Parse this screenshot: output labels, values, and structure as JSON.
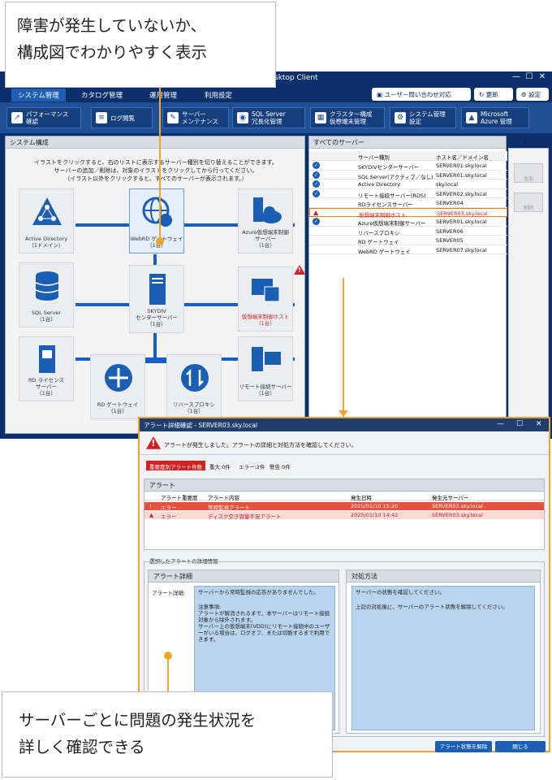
{
  "window": {
    "title": "sktop Client",
    "tabs": [
      "システム管理",
      "カタログ管理",
      "運用管理",
      "利用設定"
    ],
    "inquiry_button": "ユーザー問い合わせ対応",
    "update_button": "更新",
    "settings_button": "設定"
  },
  "toolbar": [
    {
      "label": "パフォーマンス\n確認",
      "icon": "chart-icon"
    },
    {
      "label": "ログ閲覧",
      "icon": "log-icon"
    },
    {
      "label": "サーバー\nメンテナンス",
      "icon": "wrench-icon"
    },
    {
      "label": "SQL Server\n冗長化管理",
      "icon": "database-icon"
    },
    {
      "label": "クラスター構成\n仮想端末管理",
      "icon": "cluster-icon"
    },
    {
      "label": "システム管理\n設定",
      "icon": "gear-icon"
    },
    {
      "label": "Microsoft\nAzure 管理",
      "icon": "azure-icon"
    }
  ],
  "system_pane": {
    "title": "システム構成",
    "instruction_1": "イラストをクリックすると、右のリストに表示するサーバー種別を切り替えることができます。",
    "instruction_2": "サーバーの追加／削除は、対象のイラストをクリックしてから行ってください。",
    "instruction_3": "（イラスト以外をクリックすると、すべてのサーバーが表示されます。）",
    "nodes": {
      "active_directory": [
        "Active Directory",
        "（1ドメイン）"
      ],
      "webrd": [
        "WebRD ゲートウェイ",
        "（1台）"
      ],
      "azure": [
        "Azure仮想端末制御",
        "サーバー",
        "（1台）"
      ],
      "sql": [
        "SQL Server",
        "（1台）"
      ],
      "center": [
        "SKYDIV",
        "センターサーバー",
        "（1台）"
      ],
      "vdhost": [
        "仮想端末制御ホスト",
        "（1台）"
      ],
      "rdlicense": [
        "RD ライセンス",
        "サーバー",
        "（1台）"
      ],
      "rdgateway": [
        "RD ゲートウェイ",
        "（1台）"
      ],
      "reverse_proxy": [
        "リバースプロキシ",
        "（1台）"
      ],
      "remote": [
        "リモート接続サーバー",
        "（1台）"
      ]
    }
  },
  "server_pane": {
    "title": "すべてのサーバー",
    "columns": [
      "サーバー種別",
      "ホスト名／ドメイン名"
    ],
    "rows": [
      {
        "type": "SKYDIVセンターサーバー",
        "host": "SERVER01.sky.local",
        "status": "ok"
      },
      {
        "type": "SQL Server(アクティブ／なし)",
        "host": "SERVER01.sky.local",
        "status": "ok"
      },
      {
        "type": "Active Directory",
        "host": "sky.local",
        "status": "ok"
      },
      {
        "type": "リモート接続サーバー(RDS)",
        "host": "SERVER02.sky.local",
        "status": "ok"
      },
      {
        "type": "RDライセンスサーバー",
        "host": "SERVER04",
        "status": "none"
      },
      {
        "type": "仮想端末制御ホスト",
        "host": "SERVER03.sky.local",
        "status": "alert"
      },
      {
        "type": "Azure仮想端末制御サーバー",
        "host": "SERVER01.sky.local",
        "status": "ok"
      },
      {
        "type": "リバースプロキシ",
        "host": "SERVER06",
        "status": "none"
      },
      {
        "type": "RD ゲートウェイ",
        "host": "SERVER05",
        "status": "none"
      },
      {
        "type": "WebRD ゲートウェイ",
        "host": "SERVER07.sky.local",
        "status": "none"
      }
    ],
    "add_button": "追加",
    "delete_button": "削除"
  },
  "callouts": {
    "top_line1": "障害が発生していないか、",
    "top_line2": "構成図でわかりやすく表示",
    "bottom_line1": "サーバーごとに問題の発生状況を",
    "bottom_line2": "詳しく確認できる"
  },
  "dialog": {
    "title": "アラート詳細確認 - SERVER03.sky.local",
    "message": "アラートが発生しました。アラートの詳細と対処方法を確認してください。",
    "badge": "重要度別アラート件数",
    "counts": [
      "重大:0件",
      "エラー:2件",
      "警告:0件"
    ],
    "alert_group_title": "アラート",
    "alert_columns": [
      "アラート重要度",
      "アラート内容",
      "発生日時",
      "発生元サーバー"
    ],
    "alerts": [
      {
        "level": "エラー",
        "content": "常時監視アラート",
        "date": "2025/01/10 15:20",
        "server": "SERVER03.sky.local"
      },
      {
        "level": "エラー",
        "content": "ディスク空き容量不足アラート",
        "date": "2025/01/10 14:42",
        "server": "SERVER03.sky.local"
      }
    ],
    "selected_label": "選択したアラートの詳細情報",
    "detail_title": "アラート詳細",
    "detail_label": "アラート詳細:",
    "detail_text_1": "サーバーから常時監視の応答がありませんでした。",
    "detail_text_2": "注意事項:",
    "detail_text_3": "アラートが解消されるまで、本サーバーはリモート接続対象から除外されます。",
    "detail_text_4": "サーバー上の仮想端末(VDD)にリモート接続中のユーザーがいる場合は、ログオフ、または切断するまで利用できます。",
    "action_title": "対処方法",
    "action_text_1": "サーバーの状態を確認してください。",
    "action_text_2": "上記の対処後に、サーバーのアラート状態を解除してください。",
    "release_button": "アラート状態を解除",
    "close_button": "閉じる"
  }
}
